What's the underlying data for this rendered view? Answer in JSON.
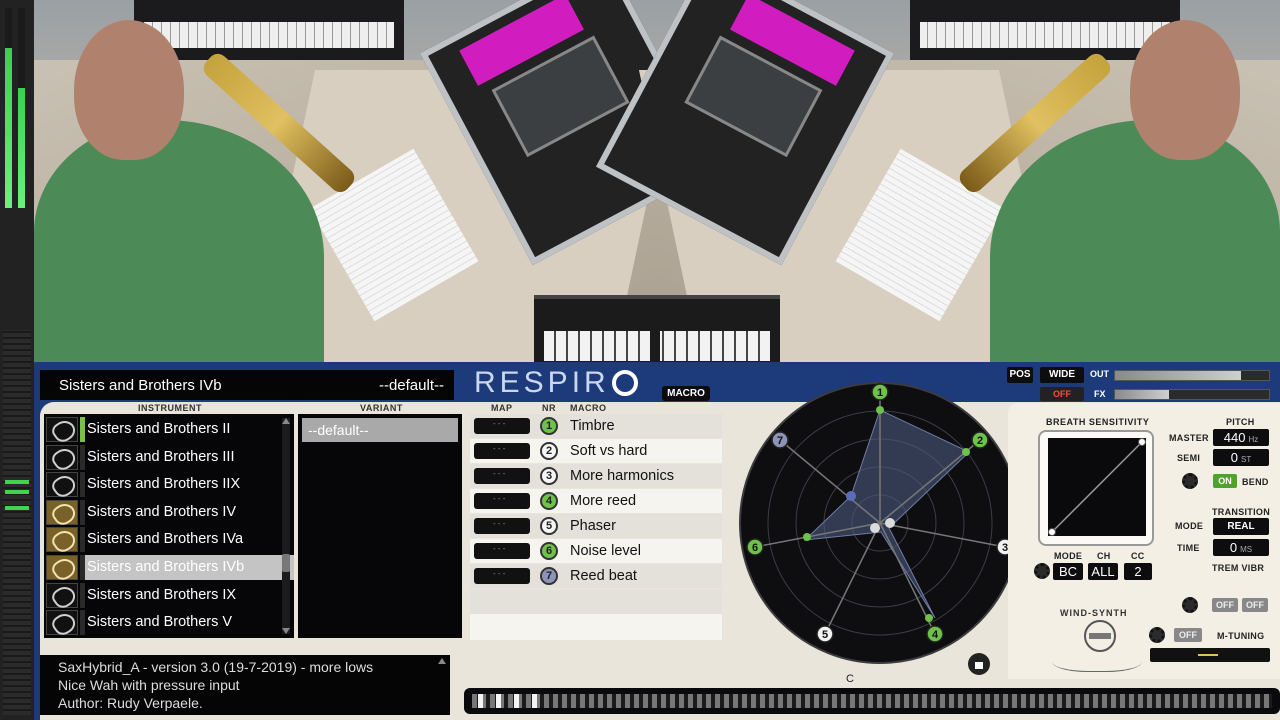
{
  "header": {
    "instrument_name": "Sisters and Brothers IVb",
    "variant_name": "--default--",
    "logo": "RESPIR",
    "macro_tab": "MACRO"
  },
  "columns": {
    "instrument": "INSTRUMENT",
    "variant": "VARIANT",
    "map": "MAP",
    "nr": "NR",
    "macro": "MACRO"
  },
  "instruments": [
    {
      "label": "Sisters and Brothers II",
      "icon": "sax-icon",
      "bar": "#7cc047",
      "selected": false
    },
    {
      "label": "Sisters and Brothers III",
      "icon": "sax-icon",
      "bar": "#2a2a2a",
      "selected": false
    },
    {
      "label": "Sisters and Brothers IIX",
      "icon": "sax-icon",
      "bar": "#2a2a2a",
      "selected": false
    },
    {
      "label": "Sisters and Brothers IV",
      "icon": "sax-gold-icon",
      "bar": "#2a2a2a",
      "selected": false
    },
    {
      "label": "Sisters and Brothers IVa",
      "icon": "sax-gold-icon",
      "bar": "#2a2a2a",
      "selected": false
    },
    {
      "label": "Sisters and Brothers IVb",
      "icon": "sax-gold-icon",
      "bar": "#2a2a2a",
      "selected": true
    },
    {
      "label": "Sisters and Brothers IX",
      "icon": "sax-icon",
      "bar": "#2a2a2a",
      "selected": false
    },
    {
      "label": "Sisters and Brothers V",
      "icon": "sax-icon",
      "bar": "#2a2a2a",
      "selected": false
    }
  ],
  "variants": [
    "--default--"
  ],
  "macros": [
    {
      "nr": "1",
      "label": "Timbre",
      "style": "green"
    },
    {
      "nr": "2",
      "label": "Soft vs hard",
      "style": "white"
    },
    {
      "nr": "3",
      "label": "More harmonics",
      "style": "white"
    },
    {
      "nr": "4",
      "label": "More reed",
      "style": "green"
    },
    {
      "nr": "5",
      "label": "Phaser",
      "style": "white"
    },
    {
      "nr": "6",
      "label": "Noise level",
      "style": "green"
    },
    {
      "nr": "7",
      "label": "Reed beat",
      "style": "blue"
    }
  ],
  "radar": {
    "labels": [
      "1",
      "2",
      "3",
      "4",
      "5",
      "6",
      "7"
    ],
    "bottom_label": "C"
  },
  "top_controls": {
    "pos": "POS",
    "wide": "WIDE",
    "off": "OFF",
    "out": "OUT",
    "fx": "FX",
    "out_level": 0.82,
    "fx_level": 0.35
  },
  "breath": {
    "title": "BREATH SENSITIVITY",
    "mode_label": "MODE",
    "ch_label": "CH",
    "cc_label": "CC",
    "mode": "BC",
    "ch": "ALL",
    "cc": "2"
  },
  "pitch": {
    "title": "PITCH",
    "master_label": "MASTER",
    "master_value": "440",
    "master_unit": "Hz",
    "semi_label": "SEMI",
    "semi_value": "0",
    "semi_unit": "ST",
    "bend_on": "ON",
    "bend_label": "BEND"
  },
  "transition": {
    "title": "TRANSITION",
    "mode_label": "MODE",
    "mode_value": "REAL",
    "time_label": "TIME",
    "time_value": "0",
    "time_unit": "MS"
  },
  "trem": {
    "title": "TREM VIBR",
    "off1": "OFF",
    "off2": "OFF"
  },
  "mtuning": {
    "off": "OFF",
    "label": "M-TUNING"
  },
  "wind_synth": "WIND-SYNTH",
  "info": {
    "line1": "SaxHybrid_A - version 3.0 (19-7-2019) - more lows",
    "line2": "Nice Wah with pressure input",
    "line3": "Author: Rudy Verpaele."
  },
  "colors": {
    "panel_blue": "#1d3a7a",
    "accent_green": "#6ec24a",
    "panel_cream": "#e9e5da"
  }
}
